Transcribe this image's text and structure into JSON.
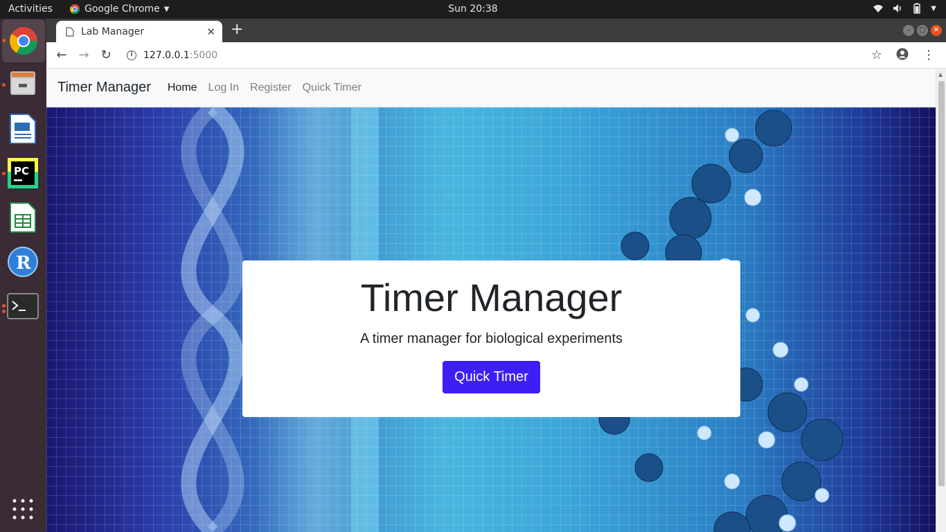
{
  "topbar": {
    "activities": "Activities",
    "app_name": "Google Chrome",
    "clock": "Sun 20:38"
  },
  "browser": {
    "tab_title": "Lab Manager",
    "url_host": "127.0.0.1",
    "url_port": ":5000"
  },
  "navbar": {
    "brand": "Timer Manager",
    "links": [
      "Home",
      "Log In",
      "Register",
      "Quick Timer"
    ]
  },
  "hero": {
    "title": "Timer Manager",
    "subtitle": "A timer manager for biological experiments",
    "button_label": "Quick Timer"
  },
  "colors": {
    "primary_button": "#3d1ff5",
    "dock_background": "#3b2b34",
    "accent": "#e95420"
  }
}
